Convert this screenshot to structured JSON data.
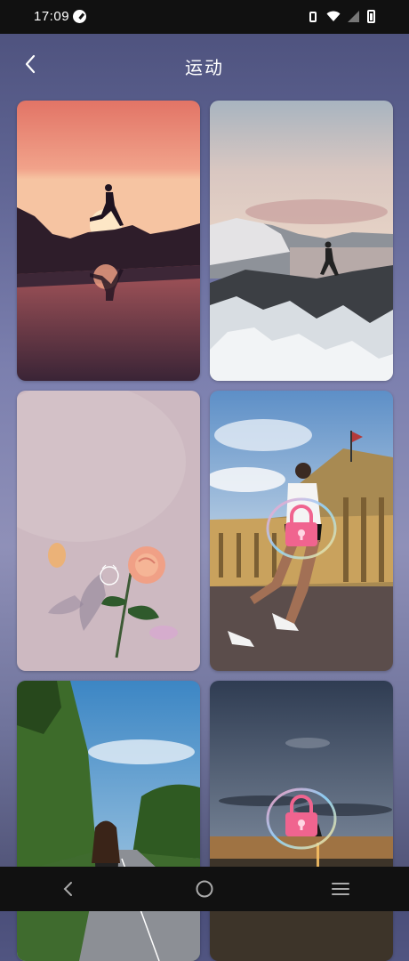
{
  "status_bar": {
    "time": "17:09",
    "icons": [
      "data-speed-icon",
      "vibrate-icon",
      "wifi-icon",
      "cell-signal-icon",
      "battery-icon"
    ]
  },
  "header": {
    "title": "运动",
    "back_icon": "chevron-left-icon"
  },
  "wallpapers": [
    {
      "scene": "runner-silhouette-sunset",
      "locked": false
    },
    {
      "scene": "runner-on-snowy-mountain",
      "locked": false
    },
    {
      "scene": "rose-shadow-pastel",
      "locked": false
    },
    {
      "scene": "runner-by-classical-building",
      "locked": true
    },
    {
      "scene": "woman-on-tropical-road",
      "locked": false
    },
    {
      "scene": "person-on-beach-sunset",
      "locked": true
    }
  ],
  "nav_bar": {
    "back_icon": "nav-back-icon",
    "home_icon": "nav-home-icon",
    "menu_icon": "nav-menu-icon"
  },
  "colors": {
    "lock_pink": "#f0648f",
    "status_bar_bg": "#111111"
  }
}
